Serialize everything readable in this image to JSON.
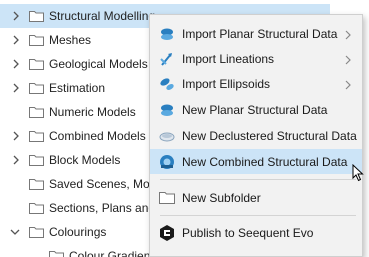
{
  "tree": {
    "items": [
      {
        "label": "Structural Modelling",
        "expanded": false
      },
      {
        "label": "Meshes",
        "expanded": false
      },
      {
        "label": "Geological Models",
        "expanded": false
      },
      {
        "label": "Estimation",
        "expanded": false
      },
      {
        "label": "Numeric Models"
      },
      {
        "label": "Combined Models",
        "expanded": false
      },
      {
        "label": "Block Models",
        "expanded": false
      },
      {
        "label": "Saved Scenes, Mov"
      },
      {
        "label": "Sections, Plans and"
      },
      {
        "label": "Colourings",
        "expanded": true
      },
      {
        "label": "Colour Gradients"
      }
    ]
  },
  "menu": {
    "items": [
      {
        "label": "Import Planar Structural Data",
        "icon": "planar-structural-import-icon",
        "submenu": true
      },
      {
        "label": "Import Lineations",
        "icon": "lineations-import-icon",
        "submenu": true
      },
      {
        "label": "Import Ellipsoids",
        "icon": "ellipsoids-import-icon",
        "submenu": true
      },
      {
        "label": "New Planar Structural Data",
        "icon": "planar-structural-new-icon"
      },
      {
        "label": "New Declustered Structural Data",
        "icon": "declustered-structural-icon"
      },
      {
        "label": "New Combined Structural Data",
        "icon": "combined-structural-icon"
      },
      {
        "label": "New Subfolder",
        "icon": "folder-icon"
      },
      {
        "label": "Publish to Seequent Evo",
        "icon": "seequent-evo-icon"
      }
    ]
  },
  "colors": {
    "selection": "#cce4f7",
    "menu_bg": "#f2f2f2",
    "icon_blue": "#2a7fc0"
  }
}
